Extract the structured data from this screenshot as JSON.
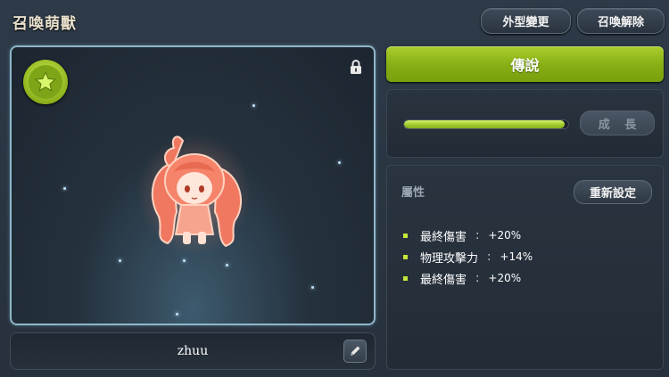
{
  "window": {
    "title": "召喚萌獸"
  },
  "top_buttons": {
    "appearance": "外型變更",
    "release": "召喚解除"
  },
  "pet": {
    "name": "zhuu",
    "grade": "傳說"
  },
  "growth": {
    "label": "成 長",
    "progress": 0.98
  },
  "attributes": {
    "header": "屬性",
    "reset_label": "重新設定",
    "items": [
      {
        "name": "最終傷害",
        "sep": ":",
        "value": "+20%"
      },
      {
        "name": "物理攻擊力",
        "sep": ":",
        "value": "+14%"
      },
      {
        "name": "最終傷害",
        "sep": ":",
        "value": "+20%"
      }
    ]
  },
  "icons": [
    "star-icon",
    "lock-icon",
    "pencil-icon"
  ],
  "colors": {
    "accent_green": "#9cc82a",
    "bullet": "#c6e83a"
  }
}
